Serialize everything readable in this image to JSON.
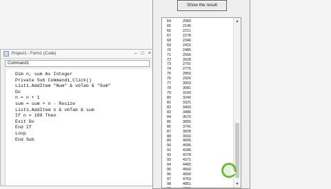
{
  "code_window": {
    "title": "Project1 - Form1 (Code)",
    "object_dropdown": "Command1",
    "lines": [
      "Dim n, sum As Integer",
      "Private Sub Command1_Click()",
      "List1.AddItem \"Num\" & vbTab & \"Sum\"",
      "Do",
      "n = n + 1",
      "sum = sum + n - Resize",
      "List1.AddItem n & vbTab & sum",
      "If n = 100 Then",
      "Exit Do",
      "End If",
      "Loop",
      "End Sub"
    ]
  },
  "form": {
    "button_label": "Show the result",
    "rows": [
      [
        "64",
        "2083"
      ],
      [
        "65",
        "2145"
      ],
      [
        "66",
        "2211"
      ],
      [
        "67",
        "2278"
      ],
      [
        "68",
        "2346"
      ],
      [
        "69",
        "2415"
      ],
      [
        "70",
        "2485"
      ],
      [
        "71",
        "2556"
      ],
      [
        "72",
        "2628"
      ],
      [
        "73",
        "2701"
      ],
      [
        "74",
        "2775"
      ],
      [
        "75",
        "2850"
      ],
      [
        "76",
        "2926"
      ],
      [
        "77",
        "3003"
      ],
      [
        "78",
        "3081"
      ],
      [
        "79",
        "3160"
      ],
      [
        "80",
        "3240"
      ],
      [
        "81",
        "3321"
      ],
      [
        "82",
        "3403"
      ],
      [
        "83",
        "3486"
      ],
      [
        "84",
        "3570"
      ],
      [
        "85",
        "3655"
      ],
      [
        "86",
        "3741"
      ],
      [
        "87",
        "3828"
      ],
      [
        "88",
        "3916"
      ],
      [
        "89",
        "4005"
      ],
      [
        "90",
        "4095"
      ],
      [
        "91",
        "4186"
      ],
      [
        "92",
        "4278"
      ],
      [
        "93",
        "4371"
      ],
      [
        "94",
        "4465"
      ],
      [
        "95",
        "4560"
      ],
      [
        "96",
        "4656"
      ],
      [
        "97",
        "4753"
      ],
      [
        "98",
        "4851"
      ],
      [
        "99",
        "4950"
      ],
      [
        "100",
        "5050"
      ]
    ]
  },
  "icons": {
    "scroll_up": "▴",
    "scroll_down": "▾",
    "minimize": "–",
    "maximize": "□",
    "close": "×"
  }
}
